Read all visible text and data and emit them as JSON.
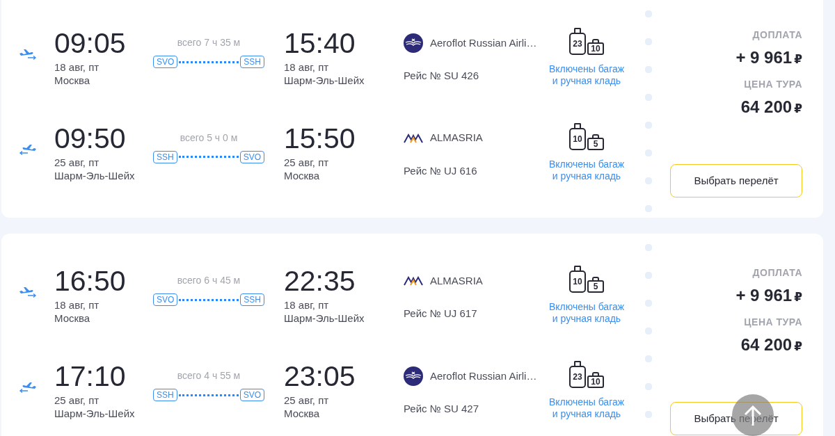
{
  "offers": [
    {
      "legs": [
        {
          "kind": "out",
          "depart_time": "09:05",
          "depart_date": "18 авг, пт",
          "depart_city": "Москва",
          "duration": "всего 7 ч 35 м",
          "from_code": "SVO",
          "to_code": "SSH",
          "arrive_time": "15:40",
          "arrive_date": "18 авг, пт",
          "arrive_city": "Шарм-Эль-Шейх",
          "airline": {
            "kind": "aeroflot",
            "name": "Aeroflot Russian Airli…"
          },
          "flight": "Рейс № SU 426",
          "suitcase": "23",
          "hand_bag": "10",
          "baggage_lines": [
            "Включены багаж",
            "и ручная кладь"
          ]
        },
        {
          "kind": "back",
          "depart_time": "09:50",
          "depart_date": "25 авг, пт",
          "depart_city": "Шарм-Эль-Шейх",
          "duration": "всего 5 ч 0 м",
          "from_code": "SSH",
          "to_code": "SVO",
          "arrive_time": "15:50",
          "arrive_date": "25 авг, пт",
          "arrive_city": "Москва",
          "airline": {
            "kind": "almasria",
            "name": "ALMASRIA"
          },
          "flight": "Рейс № UJ 616",
          "suitcase": "10",
          "hand_bag": "5",
          "baggage_lines": [
            "Включены багаж",
            "и ручная кладь"
          ]
        }
      ],
      "surcharge_label": "ДОПЛАТА",
      "surcharge": "+ 9 961",
      "surcharge_currency": "₽",
      "price_label": "ЦЕНА ТУРА",
      "price": "64 200",
      "price_currency": "₽",
      "button": "Выбрать перелёт"
    },
    {
      "legs": [
        {
          "kind": "out",
          "depart_time": "16:50",
          "depart_date": "18 авг, пт",
          "depart_city": "Москва",
          "duration": "всего 6 ч 45 м",
          "from_code": "SVO",
          "to_code": "SSH",
          "arrive_time": "22:35",
          "arrive_date": "18 авг, пт",
          "arrive_city": "Шарм-Эль-Шейх",
          "airline": {
            "kind": "almasria",
            "name": "ALMASRIA"
          },
          "flight": "Рейс № UJ 617",
          "suitcase": "10",
          "hand_bag": "5",
          "baggage_lines": [
            "Включены багаж",
            "и ручная кладь"
          ]
        },
        {
          "kind": "back",
          "depart_time": "17:10",
          "depart_date": "25 авг, пт",
          "depart_city": "Шарм-Эль-Шейх",
          "duration": "всего 4 ч 55 м",
          "from_code": "SSH",
          "to_code": "SVO",
          "arrive_time": "23:05",
          "arrive_date": "25 авг, пт",
          "arrive_city": "Москва",
          "airline": {
            "kind": "aeroflot",
            "name": "Aeroflot Russian Airli…"
          },
          "flight": "Рейс № SU 427",
          "suitcase": "23",
          "hand_bag": "10",
          "baggage_lines": [
            "Включены багаж",
            "и ручная кладь"
          ]
        }
      ],
      "surcharge_label": "ДОПЛАТА",
      "surcharge": "+ 9 961",
      "surcharge_currency": "₽",
      "price_label": "ЦЕНА ТУРА",
      "price": "64 200",
      "price_currency": "₽",
      "button": "Выбрать перелёт"
    }
  ]
}
